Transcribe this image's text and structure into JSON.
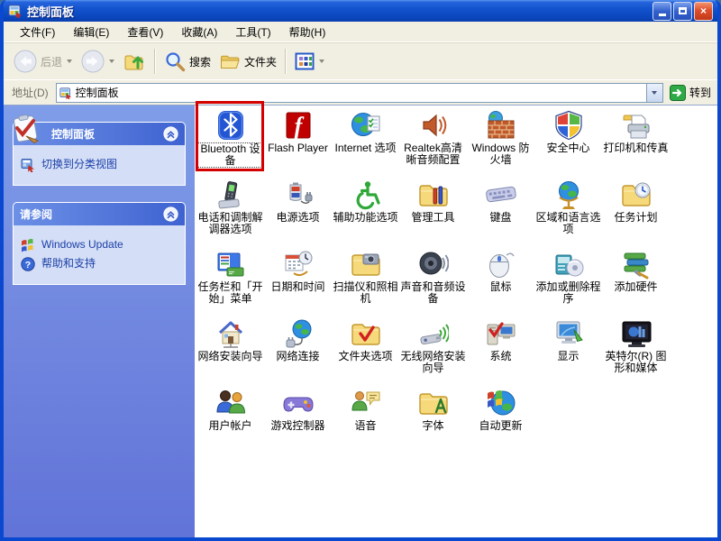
{
  "window": {
    "title": "控制面板"
  },
  "menu": {
    "items": [
      "文件(F)",
      "编辑(E)",
      "查看(V)",
      "收藏(A)",
      "工具(T)",
      "帮助(H)"
    ]
  },
  "toolbar": {
    "back_label": "后退",
    "search_label": "搜索",
    "folders_label": "文件夹"
  },
  "addressbar": {
    "label": "地址(D)",
    "value": "控制面板",
    "go_label": "转到"
  },
  "sidebar": {
    "panel1": {
      "title": "控制面板",
      "items": [
        {
          "label": "切换到分类视图",
          "icon": "category-view"
        }
      ]
    },
    "panel2": {
      "title": "请参阅",
      "items": [
        {
          "label": "Windows Update",
          "icon": "windows-update"
        },
        {
          "label": "帮助和支持",
          "icon": "help"
        }
      ]
    }
  },
  "content": {
    "items": [
      {
        "label": "Bluetooth 设备",
        "icon": "bluetooth",
        "selected": true,
        "highlighted": true
      },
      {
        "label": "Flash Player",
        "icon": "flash"
      },
      {
        "label": "Internet 选项",
        "icon": "internet"
      },
      {
        "label": "Realtek高清晰音频配置",
        "icon": "realtek-audio"
      },
      {
        "label": "Windows 防火墙",
        "icon": "firewall"
      },
      {
        "label": "安全中心",
        "icon": "security-center"
      },
      {
        "label": "打印机和传真",
        "icon": "printer"
      },
      {
        "label": "电话和调制解调器选项",
        "icon": "phone-modem"
      },
      {
        "label": "电源选项",
        "icon": "power"
      },
      {
        "label": "辅助功能选项",
        "icon": "accessibility"
      },
      {
        "label": "管理工具",
        "icon": "admin-tools"
      },
      {
        "label": "键盘",
        "icon": "keyboard"
      },
      {
        "label": "区域和语言选项",
        "icon": "regional"
      },
      {
        "label": "任务计划",
        "icon": "scheduled-tasks"
      },
      {
        "label": "任务栏和「开始」菜单",
        "icon": "taskbar"
      },
      {
        "label": "日期和时间",
        "icon": "datetime"
      },
      {
        "label": "扫描仪和照相机",
        "icon": "scanners-cameras"
      },
      {
        "label": "声音和音频设备",
        "icon": "sounds"
      },
      {
        "label": "鼠标",
        "icon": "mouse"
      },
      {
        "label": "添加或删除程序",
        "icon": "add-remove-programs"
      },
      {
        "label": "添加硬件",
        "icon": "add-hardware"
      },
      {
        "label": "网络安装向导",
        "icon": "network-wizard"
      },
      {
        "label": "网络连接",
        "icon": "network-connections"
      },
      {
        "label": "文件夹选项",
        "icon": "folder-options"
      },
      {
        "label": "无线网络安装向导",
        "icon": "wireless-wizard"
      },
      {
        "label": "系统",
        "icon": "system"
      },
      {
        "label": "显示",
        "icon": "display"
      },
      {
        "label": "英特尔(R) 图形和媒体",
        "icon": "intel-graphics"
      },
      {
        "label": "用户帐户",
        "icon": "user-accounts"
      },
      {
        "label": "游戏控制器",
        "icon": "game-controllers"
      },
      {
        "label": "语音",
        "icon": "speech"
      },
      {
        "label": "字体",
        "icon": "fonts"
      },
      {
        "label": "自动更新",
        "icon": "auto-updates"
      }
    ]
  },
  "colors": {
    "highlight_red": "#D40000",
    "go_green": "#2FA948",
    "titlebar_blue": "#0B46BC"
  }
}
